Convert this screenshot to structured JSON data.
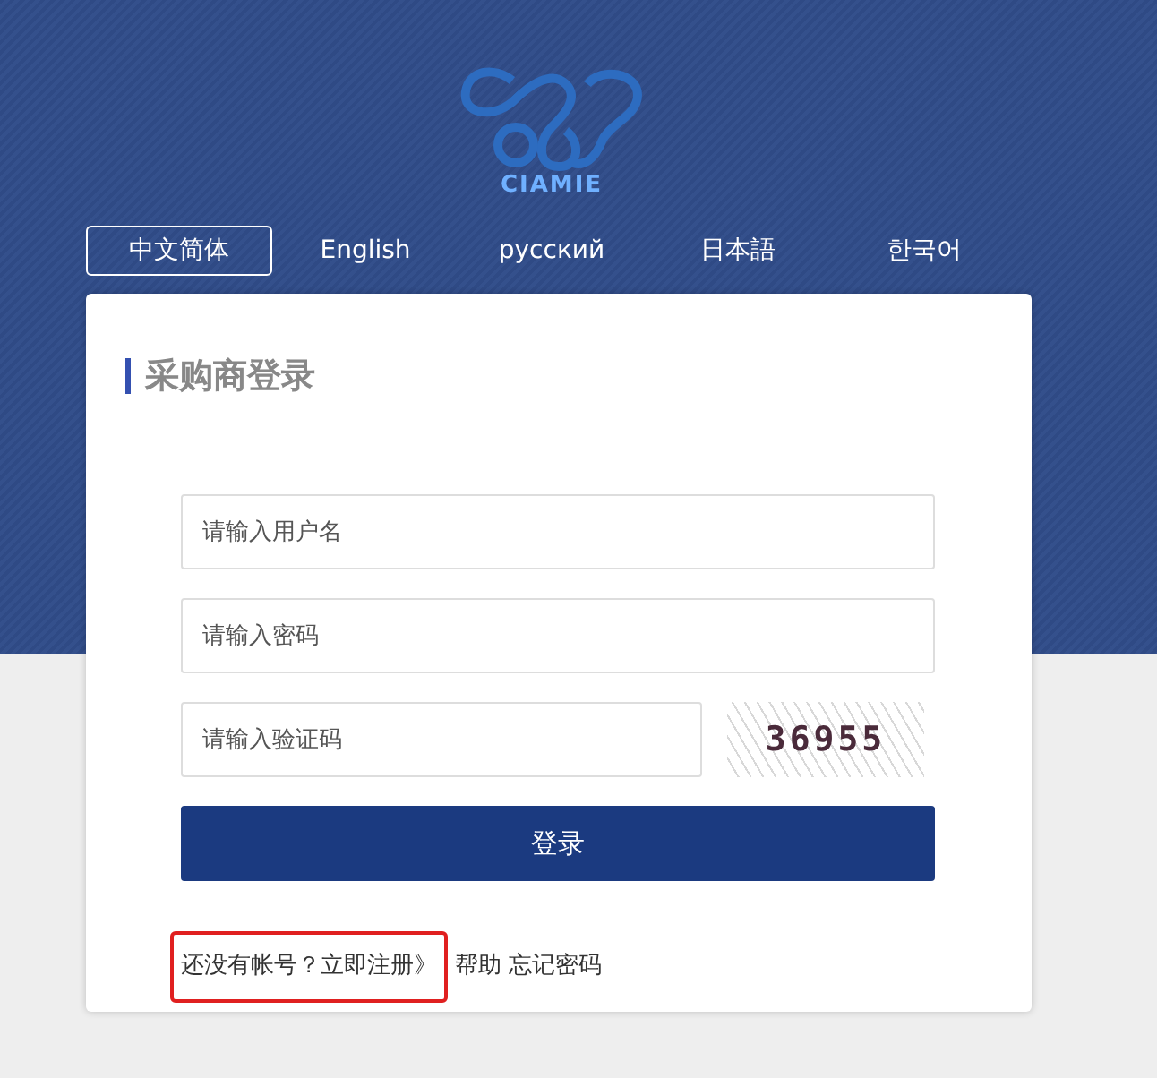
{
  "logo": {
    "text": "CIAMIE"
  },
  "languages": [
    {
      "label": "中文简体",
      "selected": true
    },
    {
      "label": "English",
      "selected": false
    },
    {
      "label": "русский",
      "selected": false
    },
    {
      "label": "日本語",
      "selected": false
    },
    {
      "label": "한국어",
      "selected": false
    }
  ],
  "login": {
    "title": "采购商登录",
    "fields": [
      {
        "placeholder": "请输入用户名"
      },
      {
        "placeholder": "请输入密码"
      },
      {
        "placeholder": "请输入验证码"
      }
    ],
    "captcha": "36955",
    "submit": "登录",
    "footer": {
      "prompt": "还没有帐号？",
      "register": "立即注册》",
      "highlighted": true,
      "links": [
        "帮助",
        "忘记密码"
      ]
    }
  }
}
